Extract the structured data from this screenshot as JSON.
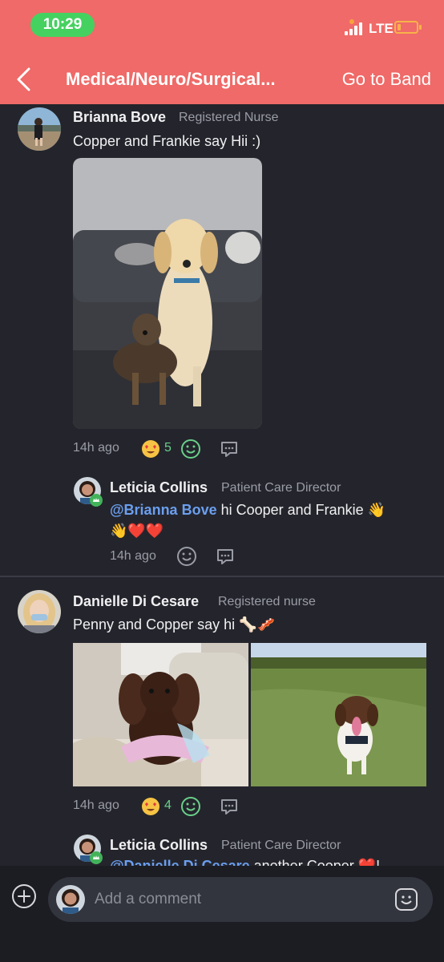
{
  "status_bar": {
    "time": "10:29",
    "network": "LTE"
  },
  "nav": {
    "title": "Medical/Neuro/Surgical...",
    "go_to_band": "Go to Band"
  },
  "posts": [
    {
      "author": "Brianna Bove",
      "role": "Registered Nurse",
      "text": "Copper and Frankie say Hii :)",
      "time": "14h ago",
      "reaction_count": "5",
      "reply": {
        "author": "Leticia Collins",
        "role": "Patient Care Director",
        "mention": "@Brianna Bove",
        "text": " hi Cooper and Frankie 👋",
        "text2": "👋❤️❤️",
        "time": "14h ago"
      }
    },
    {
      "author": "Danielle Di Cesare",
      "role": "Registered nurse",
      "text": "Penny and Copper say hi 🦴🥓",
      "time": "14h ago",
      "reaction_count": "4",
      "reply": {
        "author": "Leticia Collins",
        "role": "Patient Care Director",
        "mention": "@Danielle Di Cesare",
        "text": " another Cooper ❤️!"
      }
    }
  ],
  "composer": {
    "placeholder": "Add a comment"
  }
}
